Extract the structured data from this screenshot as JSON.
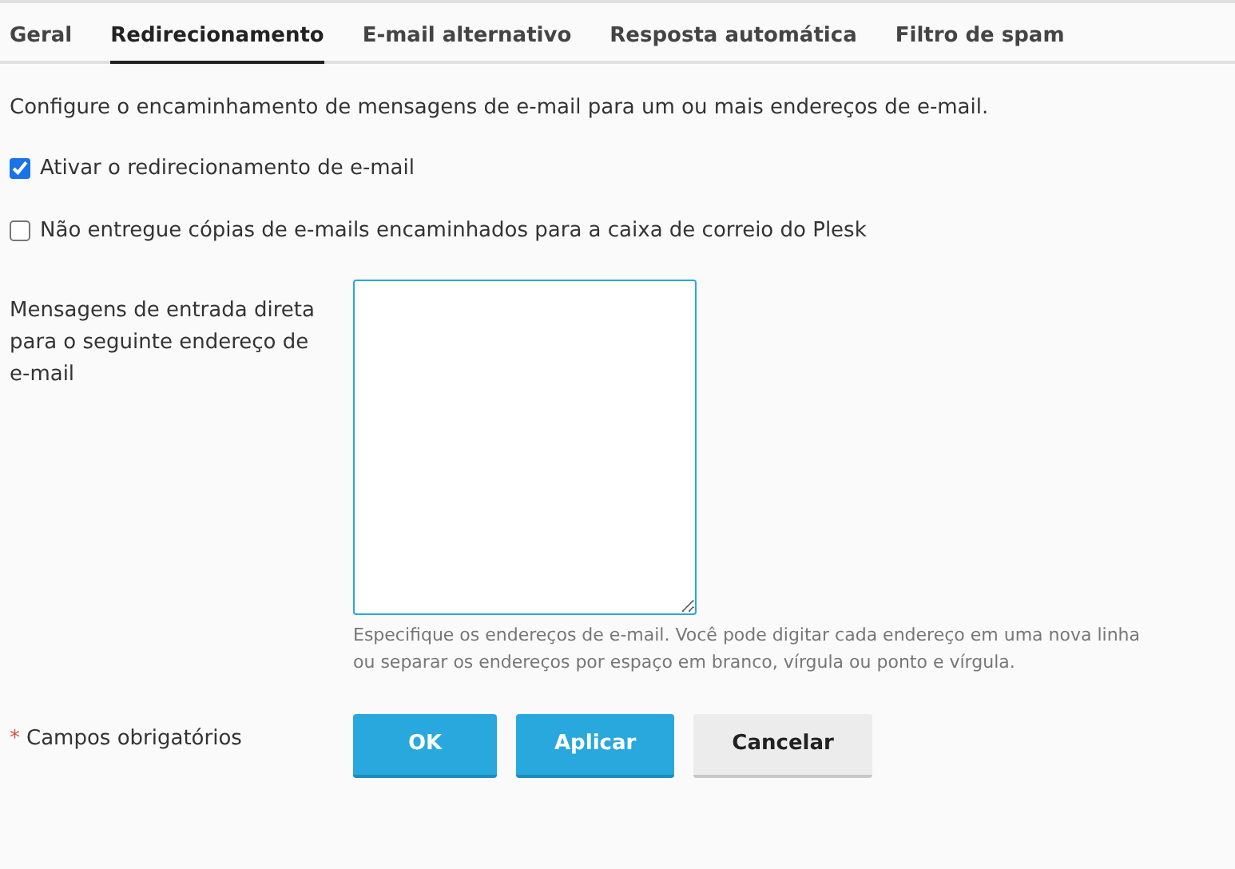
{
  "tabs": [
    {
      "label": "Geral",
      "selected": false
    },
    {
      "label": "Redirecionamento",
      "selected": true
    },
    {
      "label": "E-mail alternativo",
      "selected": false
    },
    {
      "label": "Resposta automática",
      "selected": false
    },
    {
      "label": "Filtro de spam",
      "selected": false
    }
  ],
  "description": "Configure o encaminhamento de mensagens de e-mail para um ou mais endereços de e-mail.",
  "options": [
    {
      "label": "Ativar o redirecionamento de e-mail",
      "checked": true
    },
    {
      "label": "Não entregue cópias de e-mails encaminhados para a caixa de correio do Plesk",
      "checked": false
    }
  ],
  "address_field": {
    "label": "Mensagens de entrada direta para o seguinte endereço de e-mail",
    "hint": "Especifique os endereços de e-mail. Você pode digitar cada endereço em uma nova linha ou separar os endereços por espaço em branco, vírgula ou ponto e vírgula."
  },
  "required_note": {
    "mark": "*",
    "label": "Campos obrigatórios"
  },
  "buttons": [
    {
      "label": "OK",
      "kind": "primary"
    },
    {
      "label": "Aplicar",
      "kind": "primary"
    },
    {
      "label": "Cancelar",
      "kind": "secondary"
    }
  ]
}
